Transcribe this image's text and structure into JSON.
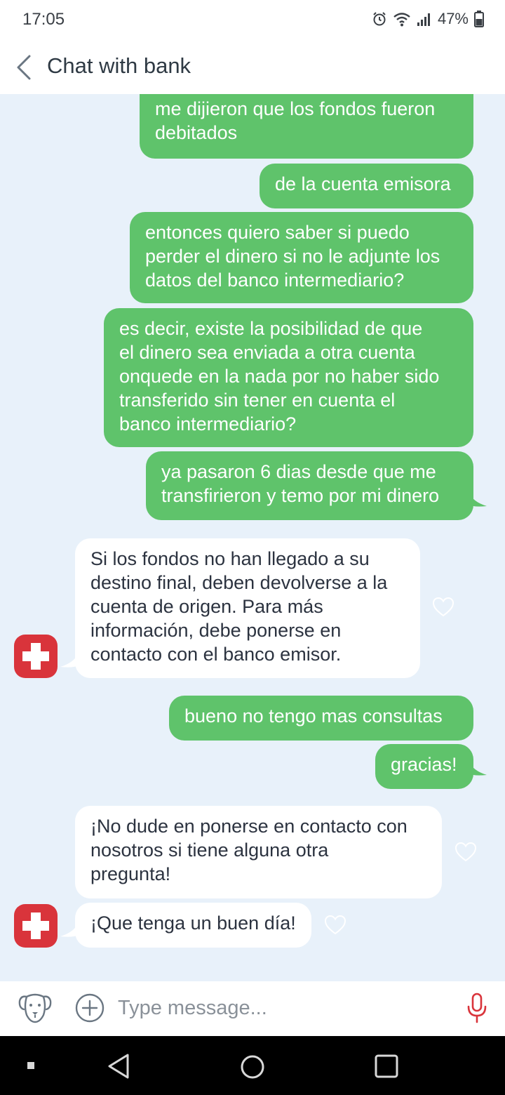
{
  "status_bar": {
    "time": "17:05",
    "battery": "47%"
  },
  "header": {
    "title": "Chat with bank"
  },
  "messages": {
    "m1": "me dijieron que los fondos fueron\ndebitados",
    "m2": "de la cuenta emisora",
    "m3": "entonces quiero saber si puedo\nperder el dinero si no le adjunte los\ndatos del banco intermediario?",
    "m4": "es decir, existe la posibilidad de que\nel dinero sea enviada a otra cuenta\nonquede en la nada por no haber sido\ntransferido sin tener en cuenta el\nbanco intermediario?",
    "m5": "ya pasaron 6 dias desde que me\ntransfirieron y temo por mi dinero",
    "m6": "Si los fondos no han llegado a su\ndestino final, deben devolverse a la\ncuenta de origen. Para más\ninformación, debe ponerse en\ncontacto con el banco emisor.",
    "m7": "bueno no tengo mas consultas",
    "m8": "gracias!",
    "m9": "¡No dude en ponerse en contacto con\nnosotros si tiene alguna otra\npregunta!",
    "m10": "¡Que tenga un buen día!"
  },
  "input": {
    "placeholder": "Type message..."
  },
  "colors": {
    "outgoing_bubble": "#5fc36b",
    "incoming_bubble": "#ffffff",
    "chat_background": "#e8f1fa",
    "bank_avatar": "#d9343b"
  }
}
